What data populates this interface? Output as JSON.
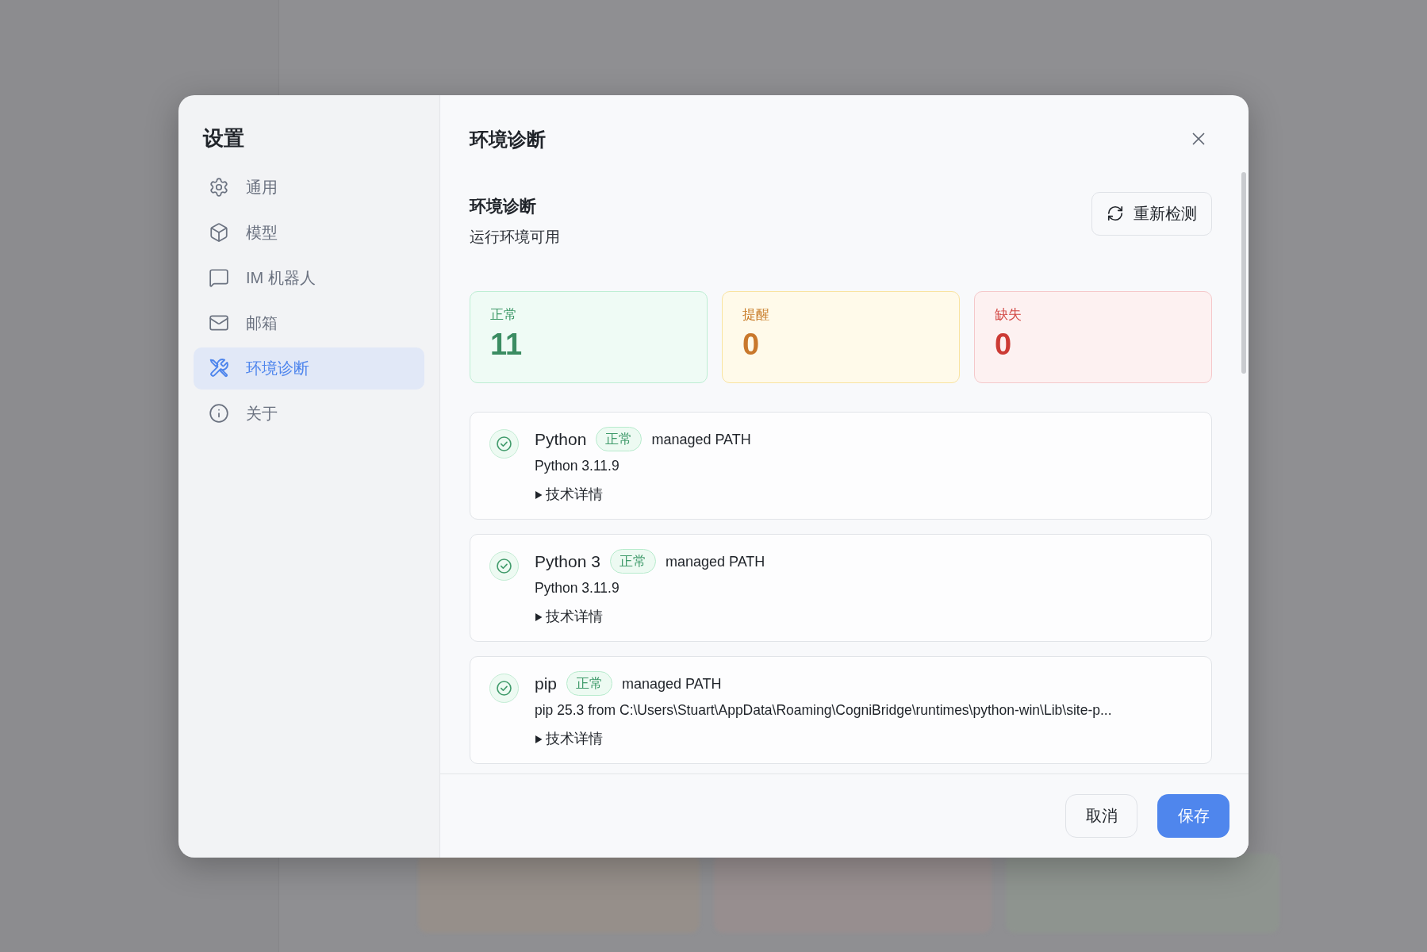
{
  "settings": {
    "title": "设置",
    "nav": [
      {
        "label": "通用",
        "selected": false
      },
      {
        "label": "模型",
        "selected": false
      },
      {
        "label": "IM 机器人",
        "selected": false
      },
      {
        "label": "邮箱",
        "selected": false
      },
      {
        "label": "环境诊断",
        "selected": true
      },
      {
        "label": "关于",
        "selected": false
      }
    ]
  },
  "panel": {
    "title": "环境诊断"
  },
  "section": {
    "title": "环境诊断",
    "subtitle": "运行环境可用",
    "recheck_button": "重新检测"
  },
  "stats": [
    {
      "kind": "ok",
      "label": "正常",
      "value": "11"
    },
    {
      "kind": "warn",
      "label": "提醒",
      "value": "0"
    },
    {
      "kind": "missing",
      "label": "缺失",
      "value": "0"
    }
  ],
  "checks": [
    {
      "kind": "ok",
      "name": "Python",
      "status": "正常",
      "source": "managed PATH",
      "detail": "Python 3.11.9",
      "toggle": {
        "label": "技术详情",
        "expanded": false
      }
    },
    {
      "kind": "ok",
      "name": "Python 3",
      "status": "正常",
      "source": "managed PATH",
      "detail": "Python 3.11.9",
      "toggle": {
        "label": "技术详情",
        "expanded": false
      }
    },
    {
      "kind": "ok",
      "name": "pip",
      "status": "正常",
      "source": "managed PATH",
      "detail": "pip 25.3 from C:\\Users\\Stuart\\AppData\\Roaming\\CogniBridge\\runtimes\\python-win\\Lib\\site-p...",
      "toggle": {
        "label": "技术详情",
        "expanded": false
      }
    }
  ],
  "footer": {
    "buttons": [
      {
        "kind": "secondary",
        "label": "取消"
      },
      {
        "kind": "primary",
        "label": "保存"
      }
    ]
  }
}
